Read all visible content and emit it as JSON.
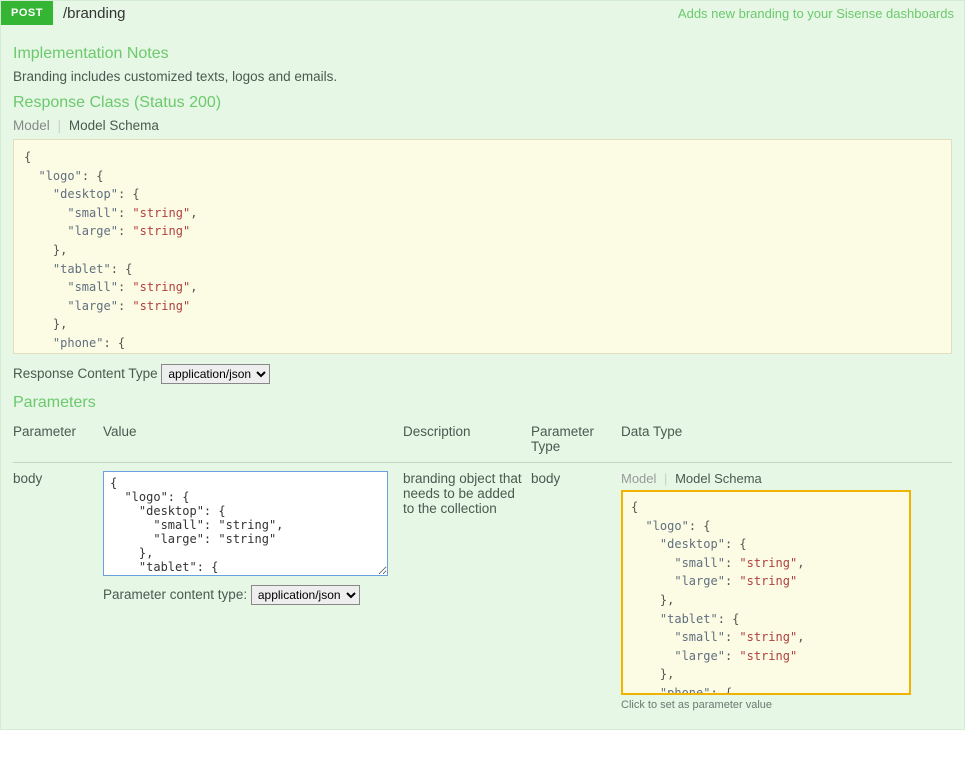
{
  "header": {
    "method": "POST",
    "path": "/branding",
    "summary": "Adds new branding to your Sisense dashboards"
  },
  "notes": {
    "heading": "Implementation Notes",
    "text": "Branding includes customized texts, logos and emails."
  },
  "response": {
    "heading": "Response Class (Status 200)",
    "tab_model": "Model",
    "tab_schema": "Model Schema",
    "ct_label": "Response Content Type",
    "ct_value": "application/json"
  },
  "schema": {
    "l1": "{",
    "l2_k": "\"logo\"",
    "l2_p": ": {",
    "l3_k": "\"desktop\"",
    "l3_p": ": {",
    "l4_k": "\"small\"",
    "l4_v": "\"string\"",
    "c": ",",
    "l5_k": "\"large\"",
    "l5_v": "\"string\"",
    "l6": "},",
    "l7_k": "\"tablet\"",
    "l7_p": ": {",
    "l10": "},",
    "l11_k": "\"phone\"",
    "l11_p": ": {"
  },
  "params": {
    "heading": "Parameters",
    "th_parameter": "Parameter",
    "th_value": "Value",
    "th_desc": "Description",
    "th_ptype": "Parameter Type",
    "th_dtype": "Data Type",
    "row1": {
      "name": "body",
      "desc": "branding object that needs to be added to the collection",
      "ptype": "body",
      "value_text": "{\n  \"logo\": {\n    \"desktop\": {\n      \"small\": \"string\",\n      \"large\": \"string\"\n    },\n    \"tablet\": {"
    },
    "ct_label": "Parameter content type:",
    "ct_value": "application/json",
    "dt_tab_model": "Model",
    "dt_tab_schema": "Model Schema",
    "hint": "Click to set as parameter value"
  }
}
